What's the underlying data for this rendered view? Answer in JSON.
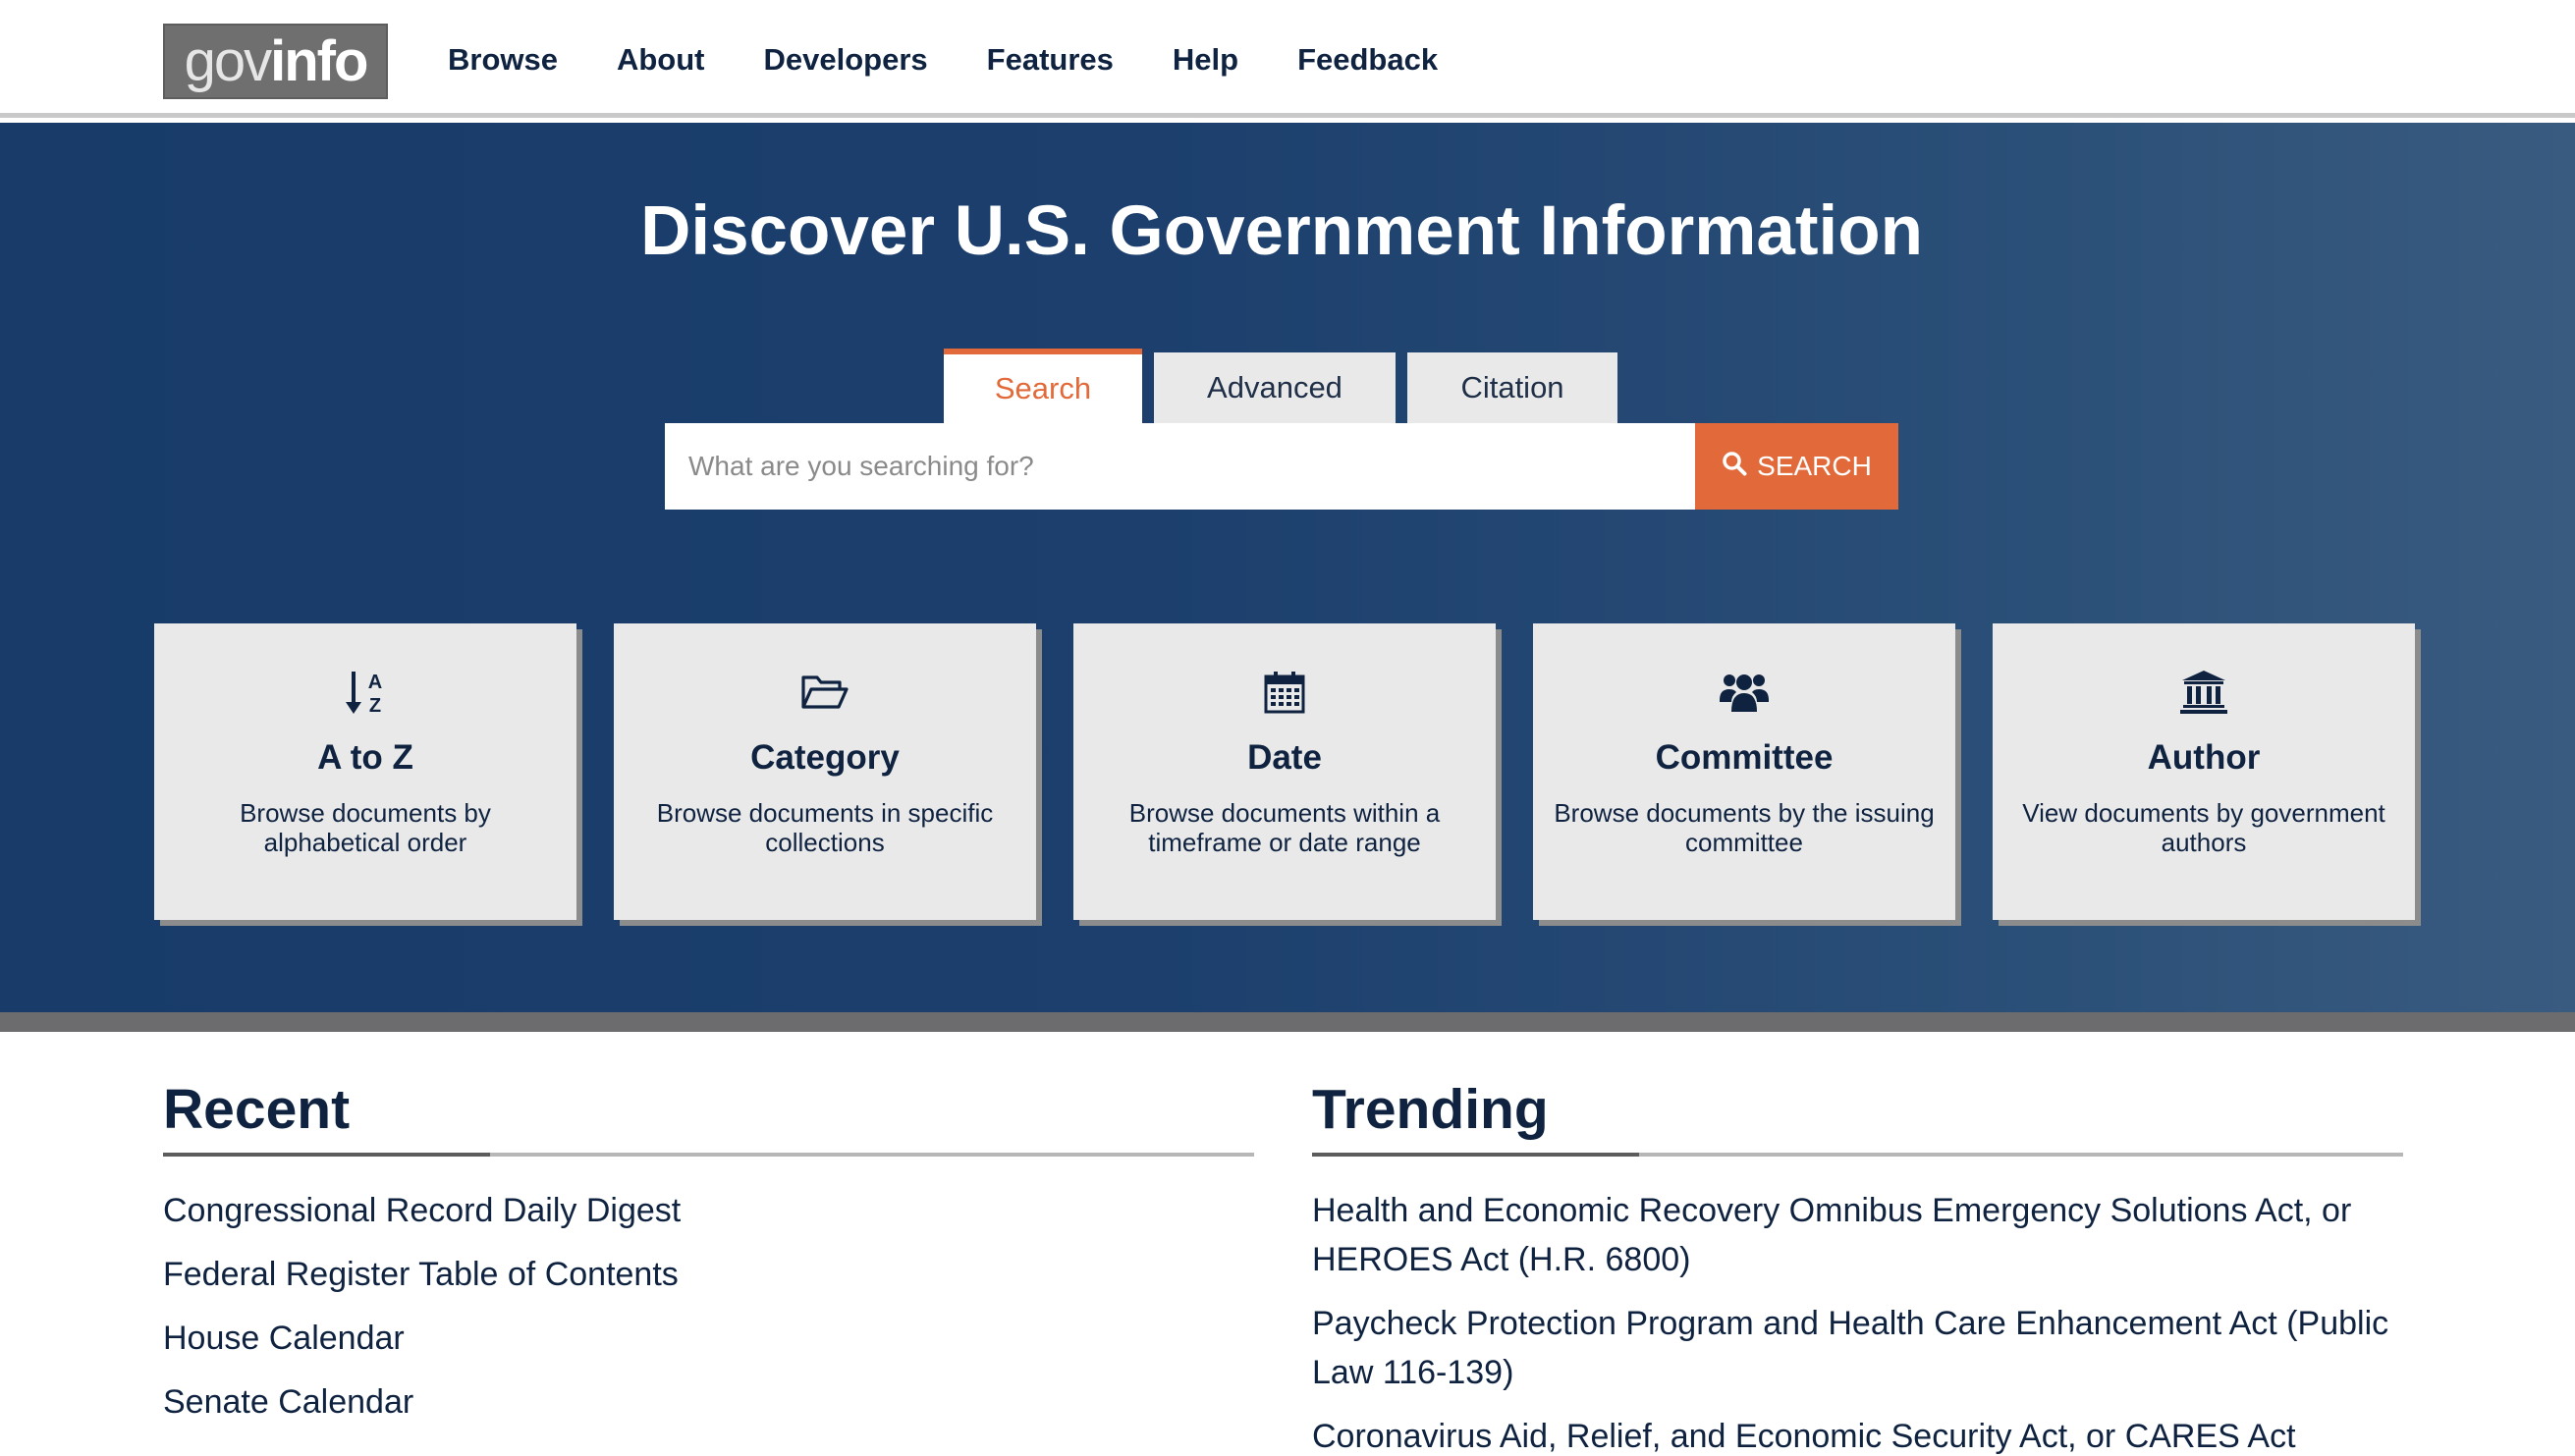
{
  "logo": {
    "gov": "gov",
    "info": "info"
  },
  "nav": {
    "items": [
      {
        "label": "Browse"
      },
      {
        "label": "About"
      },
      {
        "label": "Developers"
      },
      {
        "label": "Features"
      },
      {
        "label": "Help"
      },
      {
        "label": "Feedback"
      }
    ]
  },
  "hero": {
    "title": "Discover U.S. Government Information",
    "tabs": [
      {
        "label": "Search",
        "active": true
      },
      {
        "label": "Advanced",
        "active": false
      },
      {
        "label": "Citation",
        "active": false
      }
    ],
    "search": {
      "placeholder": "What are you searching for?",
      "value": "",
      "button_label": "SEARCH"
    }
  },
  "cards": [
    {
      "title": "A to Z",
      "desc": "Browse documents by alphabetical order",
      "icon": "sort-alpha-icon"
    },
    {
      "title": "Category",
      "desc": "Browse documents in specific collections",
      "icon": "folder-open-icon"
    },
    {
      "title": "Date",
      "desc": "Browse documents within a timeframe or date range",
      "icon": "calendar-icon"
    },
    {
      "title": "Committee",
      "desc": "Browse documents by the issuing committee",
      "icon": "users-icon"
    },
    {
      "title": "Author",
      "desc": "View documents by government authors",
      "icon": "government-building-icon"
    }
  ],
  "recent": {
    "heading": "Recent",
    "items": [
      "Congressional Record Daily Digest",
      "Federal Register Table of Contents",
      "House Calendar",
      "Senate Calendar"
    ]
  },
  "trending": {
    "heading": "Trending",
    "items": [
      "Health and Economic Recovery Omnibus Emergency Solutions Act, or HEROES Act (H.R. 6800)",
      "Paycheck Protection Program and Health Care Enhancement Act (Public Law 116-139)",
      "Coronavirus Aid, Relief, and Economic Security Act, or CARES Act"
    ]
  },
  "colors": {
    "navy": "#0f2340",
    "hero_bg": "#1c3f6d",
    "accent": "#e26a3a",
    "card_bg": "#e9e9e9"
  }
}
